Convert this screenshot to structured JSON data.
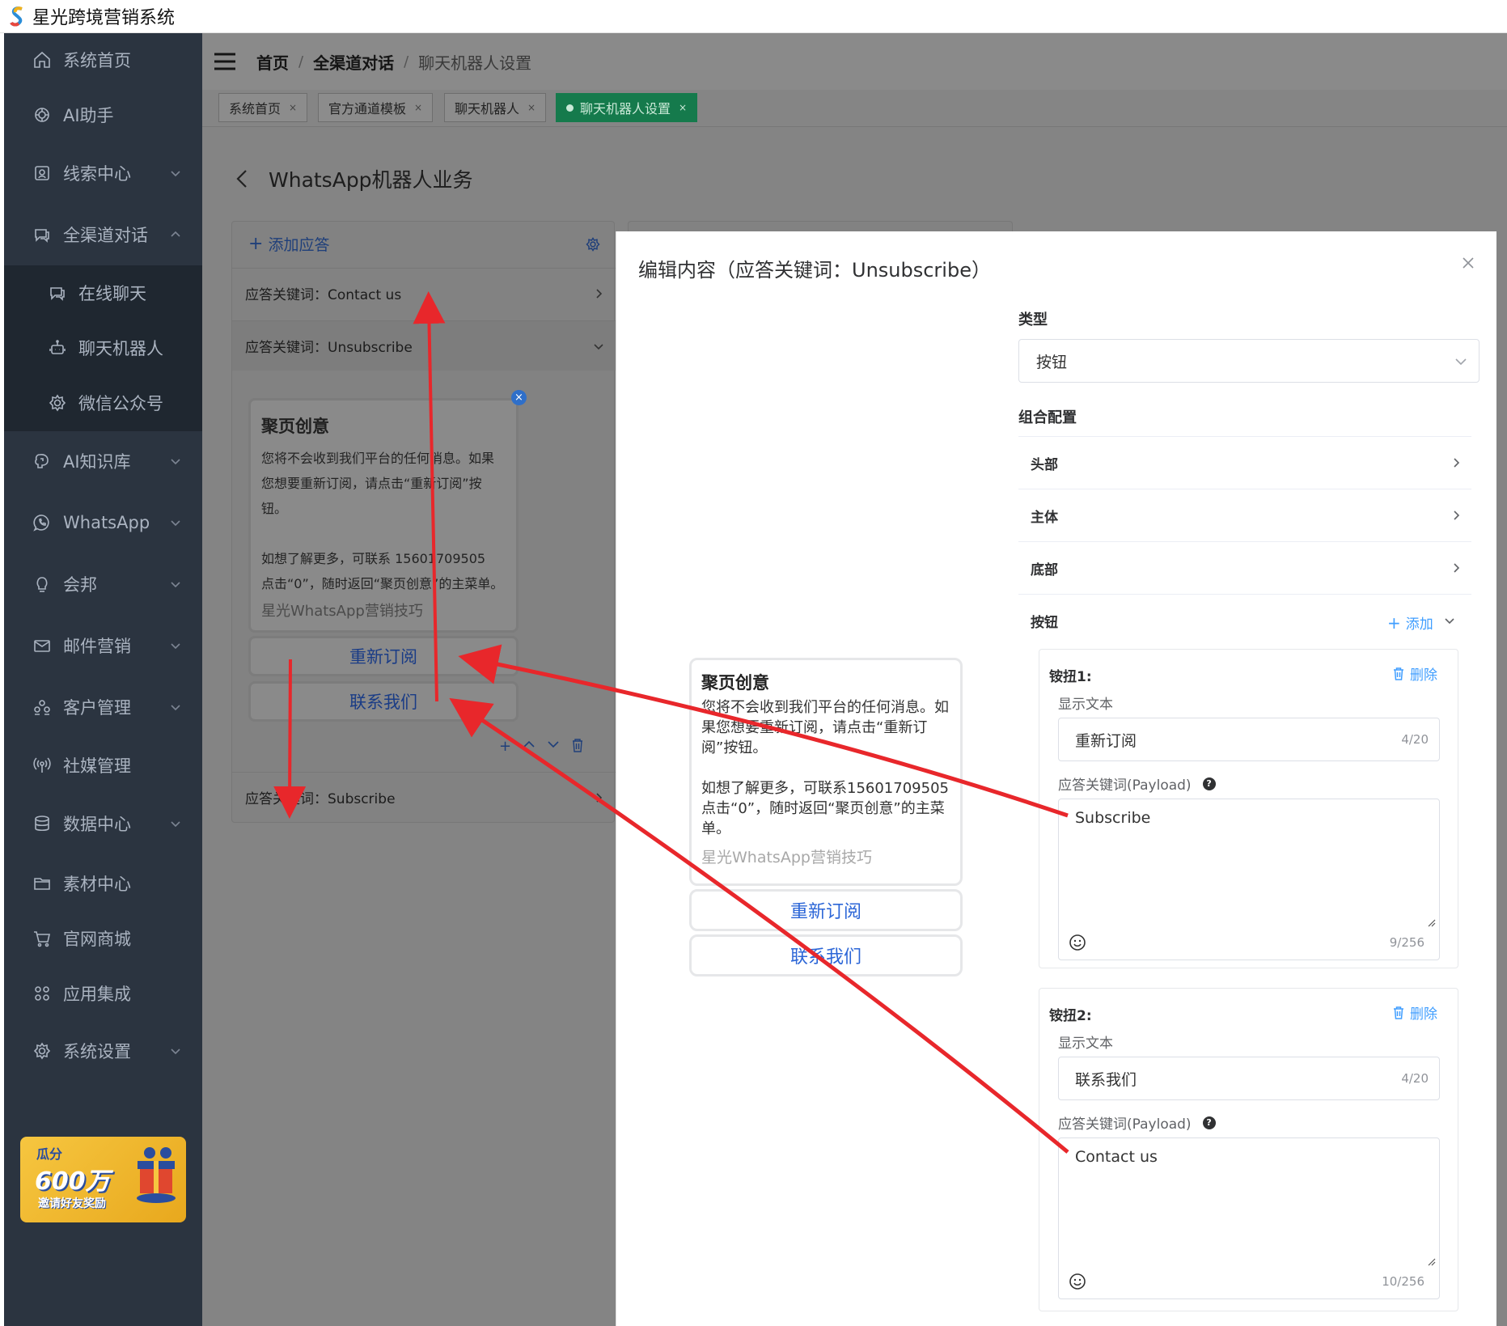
{
  "app": {
    "title": "星光跨境营销系统"
  },
  "sidebar": {
    "items": [
      {
        "label": "系统首页",
        "icon": "home-icon"
      },
      {
        "label": "AI助手",
        "icon": "ai-icon"
      },
      {
        "label": "线索中心",
        "icon": "clue-icon"
      },
      {
        "label": "全渠道对话",
        "icon": "chat-icon"
      },
      {
        "label": "在线聊天",
        "icon": "chat-icon"
      },
      {
        "label": "聊天机器人",
        "icon": "robot-icon"
      },
      {
        "label": "微信公众号",
        "icon": "gear-icon"
      },
      {
        "label": "AI知识库",
        "icon": "brain-icon"
      },
      {
        "label": "WhatsApp",
        "icon": "whatsapp-icon"
      },
      {
        "label": "会邦",
        "icon": "bulb-icon"
      },
      {
        "label": "邮件营销",
        "icon": "mail-icon"
      },
      {
        "label": "客户管理",
        "icon": "users-icon"
      },
      {
        "label": "社媒管理",
        "icon": "broadcast-icon"
      },
      {
        "label": "数据中心",
        "icon": "database-icon"
      },
      {
        "label": "素材中心",
        "icon": "folder-icon"
      },
      {
        "label": "官网商城",
        "icon": "cart-icon"
      },
      {
        "label": "应用集成",
        "icon": "apps-icon"
      },
      {
        "label": "系统设置",
        "icon": "settings-icon"
      }
    ],
    "promo": {
      "line1": "瓜分",
      "line2": "600万",
      "line3": "邀请好友奖励"
    }
  },
  "breadcrumb": {
    "items": [
      "首页",
      "全渠道对话"
    ],
    "current": "聊天机器人设置",
    "separator": "/"
  },
  "tags": [
    {
      "label": "系统首页",
      "close": "×"
    },
    {
      "label": "官方通道模板",
      "close": "×"
    },
    {
      "label": "聊天机器人",
      "close": "×"
    },
    {
      "label": "聊天机器人设置",
      "close": "×"
    }
  ],
  "page": {
    "title": "WhatsApp机器人业务"
  },
  "left_panel": {
    "add_label": "添加应答",
    "replies": [
      {
        "keyword": "应答关键词：Contact us"
      },
      {
        "keyword": "应答关键词：Unsubscribe"
      },
      {
        "keyword": "应答关键词：Subscribe"
      }
    ],
    "message": {
      "title": "聚页创意",
      "body": "您将不会收到我们平台的任何消息。如果您想要重新订阅，请点击“重新订阅”按钮。\n\n如想了解更多，可联系 15601709505\n点击“0”，随时返回“聚页创意”的主菜单。",
      "footer": "星光WhatsApp营销技巧",
      "buttons": [
        "重新订阅",
        "联系我们"
      ]
    }
  },
  "modal": {
    "title": "编辑内容（应答关键词：Unsubscribe）",
    "preview": {
      "title": "聚页创意",
      "body": "您将不会收到我们平台的任何消息。如果您想要重新订阅，请点击“重新订阅”按钮。\n\n如想了解更多，可联系15601709505\n点击“0”，随时返回“聚页创意”的主菜单。",
      "footer": "星光WhatsApp营销技巧",
      "buttons": [
        "重新订阅",
        "联系我们"
      ]
    },
    "type_label": "类型",
    "type_value": "按钮",
    "combo_label": "组合配置",
    "sections": [
      "头部",
      "主体",
      "底部"
    ],
    "buttons_section": {
      "label": "按钮",
      "add_label": "添加"
    },
    "buttons": [
      {
        "header": "铵扭1:",
        "delete_label": "删除",
        "display_text_label": "显示文本",
        "display_text": "重新订阅",
        "display_count": "4/20",
        "payload_label": "应答关键词(Payload)",
        "payload": "Subscribe",
        "payload_count": "9/256"
      },
      {
        "header": "铵扭2:",
        "delete_label": "删除",
        "display_text_label": "显示文本",
        "display_text": "联系我们",
        "display_count": "4/20",
        "payload_label": "应答关键词(Payload)",
        "payload": "Contact us",
        "payload_count": "10/256"
      }
    ]
  },
  "colors": {
    "accent": "#409eff",
    "sidebar_bg": "#2b3440",
    "active_tag": "#157a4c",
    "arrow": "#e8272b"
  }
}
